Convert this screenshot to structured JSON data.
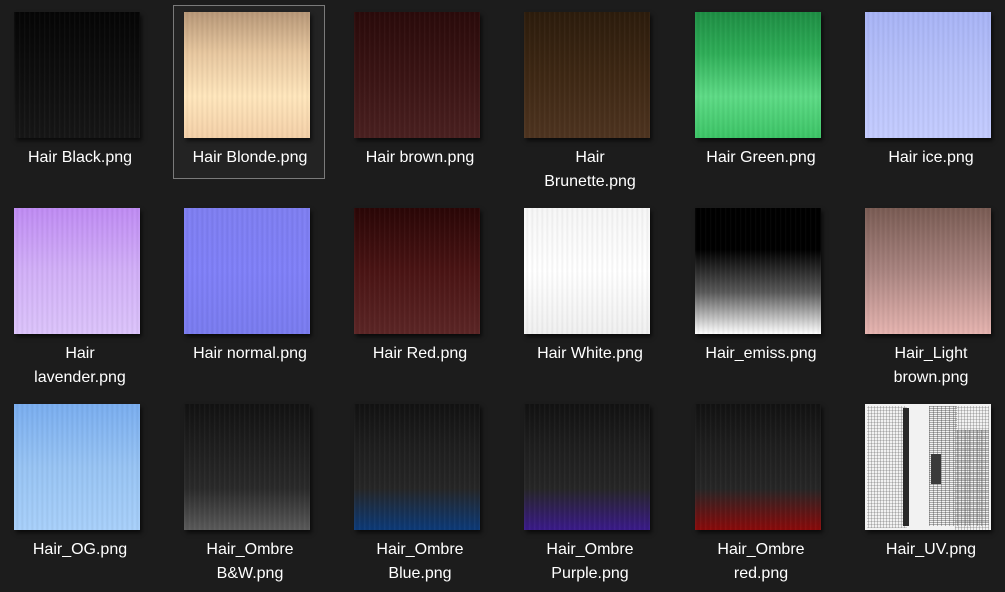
{
  "files": [
    {
      "name": "Hair Black.png",
      "icon": "hair-texture-black",
      "colors": [
        "#050505",
        "#161616"
      ]
    },
    {
      "name": "Hair Blonde.png",
      "icon": "hair-texture-blonde",
      "colors": [
        "#b89878",
        "#e8c8a0",
        "#ffe6bc",
        "#f4d0a8"
      ],
      "selected": true
    },
    {
      "name": "Hair brown.png",
      "icon": "hair-texture-brown",
      "colors": [
        "#2a0a0a",
        "#3a1414",
        "#4a2020"
      ]
    },
    {
      "name": "Hair Brunette.png",
      "icon": "hair-texture-brunette",
      "colors": [
        "#2c1c0c",
        "#3e2814",
        "#4e3420"
      ]
    },
    {
      "name": "Hair Green.png",
      "icon": "hair-texture-green",
      "colors": [
        "#1e8e44",
        "#2fae58",
        "#5edb86",
        "#3cc466"
      ]
    },
    {
      "name": "Hair ice.png",
      "icon": "hair-texture-ice",
      "colors": [
        "#a8b4f6",
        "#b8c2fa",
        "#c4ccff"
      ]
    },
    {
      "name": "Hair lavender.png",
      "icon": "hair-texture-lavender",
      "colors": [
        "#c08cf4",
        "#d2b0f8",
        "#dcc4fb"
      ]
    },
    {
      "name": "Hair normal.png",
      "icon": "hair-texture-normal",
      "colors": [
        "#7f7ff2",
        "#8080f8",
        "#7a7cf0"
      ]
    },
    {
      "name": "Hair Red.png",
      "icon": "hair-texture-red",
      "colors": [
        "#2a0606",
        "#4a1414",
        "#5c2626"
      ]
    },
    {
      "name": "Hair White.png",
      "icon": "hair-texture-white",
      "colors": [
        "#f6f6f6",
        "#ffffff",
        "#f0f0f0"
      ]
    },
    {
      "name": "Hair_emiss.png",
      "icon": "hair-texture-emissive",
      "colors": [
        "#000000",
        "#000000",
        "#5a5a5a",
        "#ffffff"
      ]
    },
    {
      "name": "Hair_Light brown.png",
      "icon": "hair-texture-light-brown",
      "colors": [
        "#7a5c54",
        "#a98480",
        "#e6b4b0"
      ]
    },
    {
      "name": "Hair_OG.png",
      "icon": "hair-texture-og",
      "colors": [
        "#7aaef0",
        "#98c4f4",
        "#a8d0fa"
      ]
    },
    {
      "name": "Hair_Ombre B&W.png",
      "icon": "hair-texture-ombre-bw",
      "colors": [
        "#121212",
        "#1e1e1e",
        "#2a2a2a",
        "#5a5a5a"
      ]
    },
    {
      "name": "Hair_Ombre Blue.png",
      "icon": "hair-texture-ombre-blue",
      "colors": [
        "#121212",
        "#1e1e1e",
        "#262626",
        "#0c3a78"
      ]
    },
    {
      "name": "Hair_Ombre Purple.png",
      "icon": "hair-texture-ombre-purple",
      "colors": [
        "#121212",
        "#1e1e1e",
        "#262626",
        "#3a1a8a"
      ]
    },
    {
      "name": "Hair_Ombre red.png",
      "icon": "hair-texture-ombre-red",
      "colors": [
        "#121212",
        "#1e1e1e",
        "#262626",
        "#8a0a0a"
      ]
    },
    {
      "name": "Hair_UV.png",
      "icon": "hair-texture-uv-layout",
      "colors": [
        "#f2f2f2"
      ]
    }
  ]
}
